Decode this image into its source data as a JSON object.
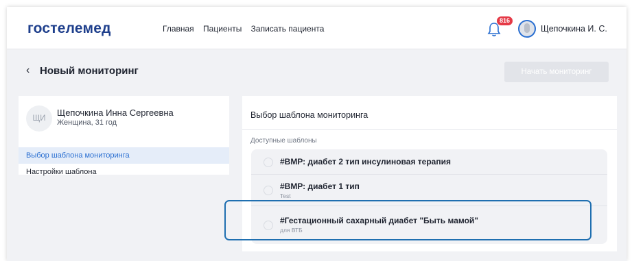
{
  "header": {
    "logo": "гостелемед",
    "nav": [
      "Главная",
      "Пациенты",
      "Записать пациента"
    ],
    "notification_count": "816",
    "user_name": "Щепочкина И. С."
  },
  "page": {
    "back_icon": "chevron-left-icon",
    "title": "Новый мониторинг",
    "start_button": "Начать мониторинг"
  },
  "patient": {
    "initials": "ЩИ",
    "name": "Щепочкина Инна Сергеевна",
    "details": "Женщина, 31 год"
  },
  "sidebar": {
    "items": [
      {
        "label": "Выбор шаблона мониторинга",
        "active": true
      },
      {
        "label": "Настройки шаблона",
        "active": false
      }
    ]
  },
  "main": {
    "title": "Выбор шаблона мониторинга",
    "section_label": "Доступные шаблоны",
    "templates": [
      {
        "title": "#ВМР: диабет 2 тип инсулиновая терапия",
        "subtitle": ""
      },
      {
        "title": "#ВМР: диабет 1 тип",
        "subtitle": "Test"
      },
      {
        "title": "#Гестационный сахарный диабет \"Быть мамой\"",
        "subtitle": "для ВТБ"
      }
    ]
  },
  "colors": {
    "brand": "#1e3f8c",
    "accent": "#2a6fd1",
    "badge": "#e53946",
    "highlight": "#1f6fb0"
  }
}
